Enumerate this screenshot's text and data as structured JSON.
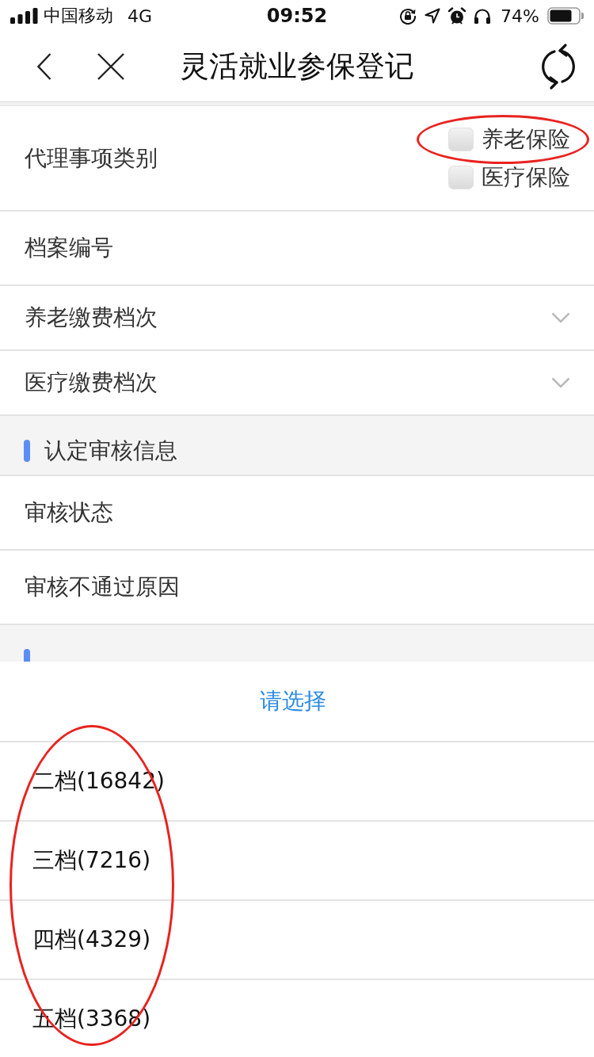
{
  "status_bar": {
    "carrier": "中国移动",
    "network": "4G",
    "time": "09:52",
    "battery": "74%"
  },
  "nav": {
    "title": "灵活就业参保登记"
  },
  "form": {
    "rows": [
      {
        "kind": "checkbox_group",
        "label": "代理事项类别",
        "options": [
          {
            "label": "养老保险",
            "checked": false,
            "circled": true
          },
          {
            "label": "医疗保险",
            "checked": false,
            "circled": false
          }
        ]
      },
      {
        "kind": "text",
        "label": "档案编号"
      },
      {
        "kind": "select",
        "label": "养老缴费档次"
      },
      {
        "kind": "select",
        "label": "医疗缴费档次"
      },
      {
        "kind": "section",
        "title": "认定审核信息"
      },
      {
        "kind": "text",
        "label": "审核状态"
      },
      {
        "kind": "text",
        "label": "审核不通过原因"
      },
      {
        "kind": "section"
      }
    ]
  },
  "picker": {
    "title": "请选择",
    "circled": true,
    "options": [
      {
        "label": "二档(16842)",
        "selected": false
      },
      {
        "label": "三档(7216)",
        "selected": false
      },
      {
        "label": "四档(4329)",
        "selected": false
      },
      {
        "label": "五档(3368)",
        "selected": false
      }
    ]
  }
}
